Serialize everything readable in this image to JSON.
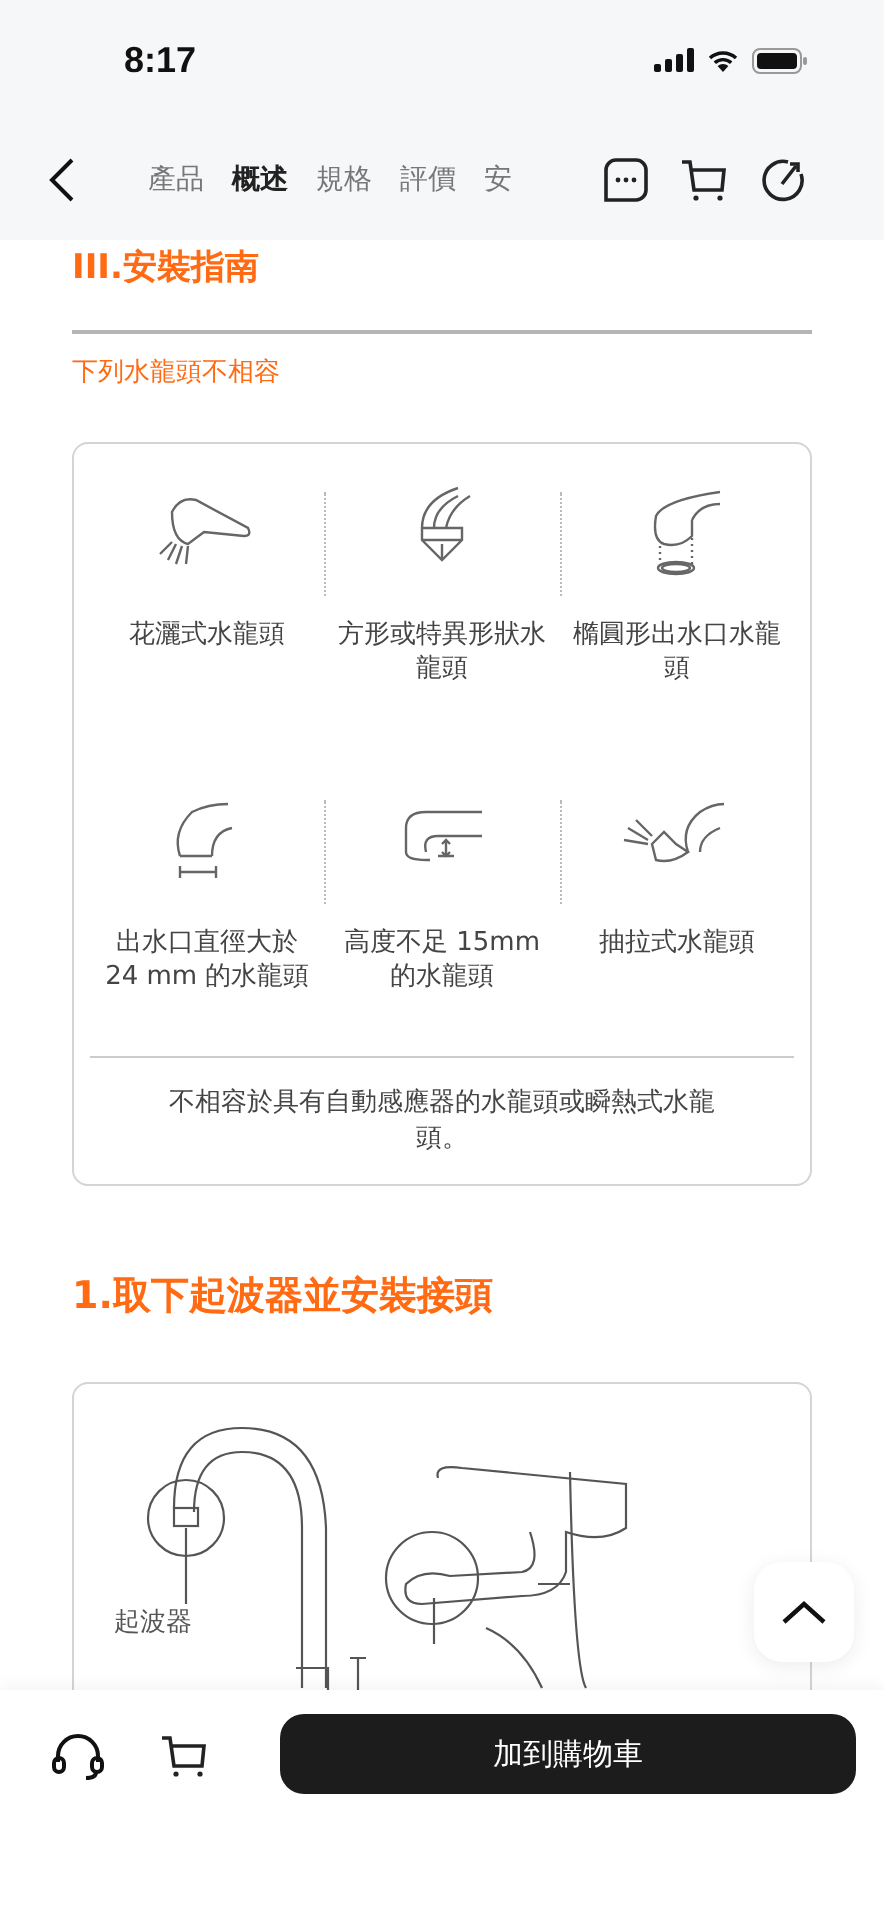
{
  "status_bar": {
    "time": "8:17"
  },
  "nav": {
    "tabs": [
      {
        "label": "產品",
        "selected": false
      },
      {
        "label": "概述",
        "selected": true
      },
      {
        "label": "規格",
        "selected": false
      },
      {
        "label": "評價",
        "selected": false
      },
      {
        "label": "安",
        "selected": false
      }
    ]
  },
  "section": {
    "title": "III.安裝指南",
    "subtitle": "下列水龍頭不相容",
    "incompatible": [
      {
        "label": "花灑式水龍頭"
      },
      {
        "label": "方形或特異形狀水龍頭"
      },
      {
        "label": "橢圓形出水口水龍頭"
      },
      {
        "label": "出水口直徑大於 24 mm 的水龍頭"
      },
      {
        "label": "高度不足 15mm 的水龍頭"
      },
      {
        "label": "抽拉式水龍頭"
      }
    ],
    "note": "不相容於具有自動感應器的水龍頭或瞬熱式水龍頭。"
  },
  "step": {
    "title": "1.取下起波器並安裝接頭",
    "callout": "起波器"
  },
  "bottom_bar": {
    "add_to_cart": "加到購物車"
  }
}
